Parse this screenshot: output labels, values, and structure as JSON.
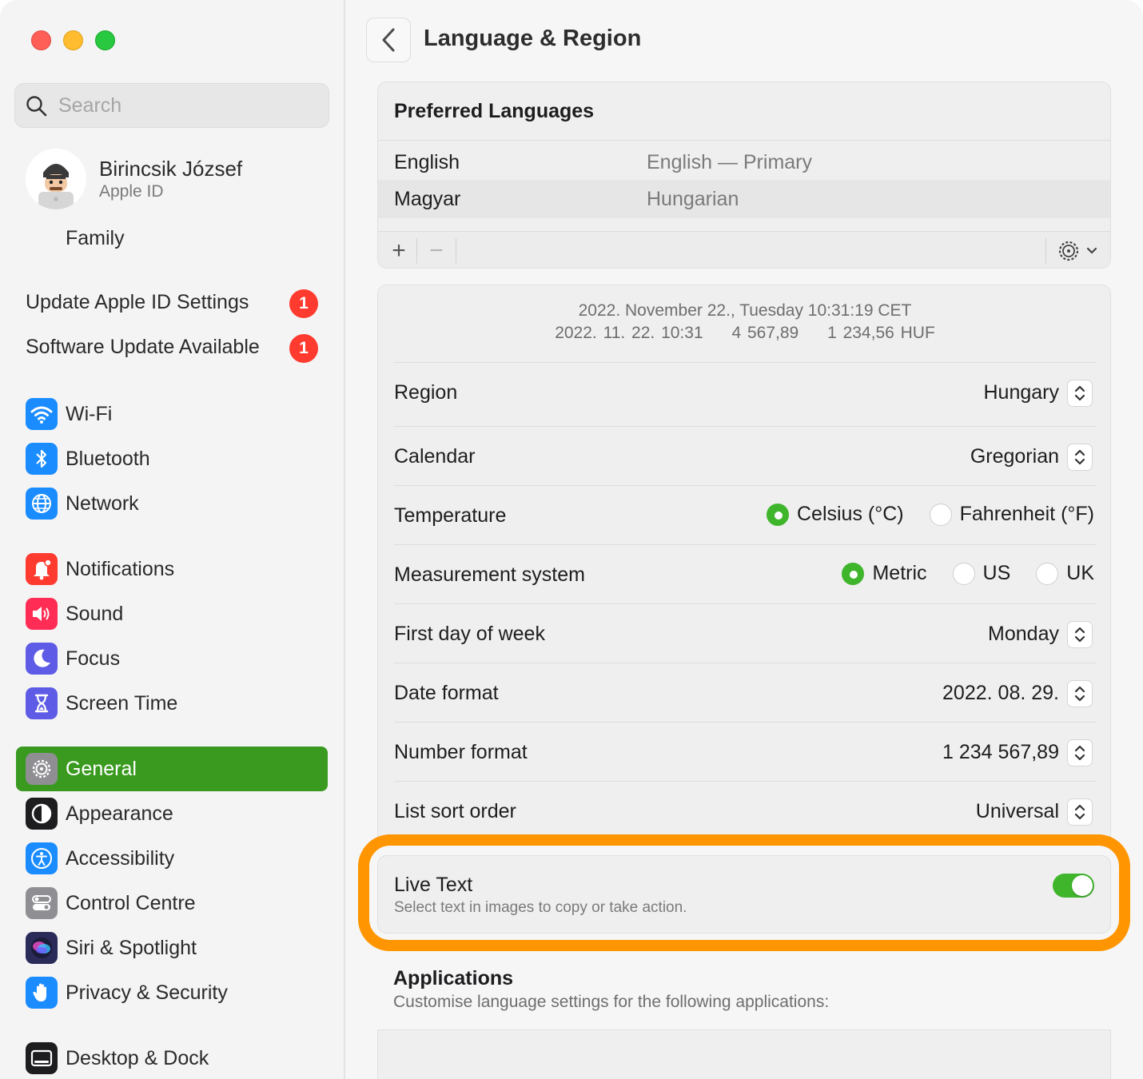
{
  "sidebar": {
    "search_placeholder": "Search",
    "account": {
      "name": "Birincsik József",
      "subtitle": "Apple ID"
    },
    "family": "Family",
    "alerts": [
      {
        "label": "Update Apple ID Settings",
        "badge": "1"
      },
      {
        "label": "Software Update Available",
        "badge": "1"
      }
    ],
    "items": [
      {
        "label": "Wi-Fi",
        "icon": "wifi-icon",
        "color": "#1a8cff"
      },
      {
        "label": "Bluetooth",
        "icon": "bluetooth-icon",
        "color": "#1a8cff"
      },
      {
        "label": "Network",
        "icon": "globe-icon",
        "color": "#1a8cff"
      },
      {
        "label": "Notifications",
        "icon": "bell-icon",
        "color": "#ff3b30"
      },
      {
        "label": "Sound",
        "icon": "speaker-icon",
        "color": "#ff2d55"
      },
      {
        "label": "Focus",
        "icon": "moon-icon",
        "color": "#5e5ce6"
      },
      {
        "label": "Screen Time",
        "icon": "hourglass-icon",
        "color": "#5e5ce6"
      },
      {
        "label": "General",
        "icon": "gear-icon",
        "color": "#8e8e93",
        "active": true
      },
      {
        "label": "Appearance",
        "icon": "appearance-icon",
        "color": "#1d1d1f"
      },
      {
        "label": "Accessibility",
        "icon": "accessibility-icon",
        "color": "#1a8cff"
      },
      {
        "label": "Control Centre",
        "icon": "toggles-icon",
        "color": "#8e8e93"
      },
      {
        "label": "Siri & Spotlight",
        "icon": "siri-icon",
        "color": "#2b2b5a"
      },
      {
        "label": "Privacy & Security",
        "icon": "hand-icon",
        "color": "#1a8cff"
      },
      {
        "label": "Desktop & Dock",
        "icon": "dock-icon",
        "color": "#1d1d1f"
      }
    ]
  },
  "main": {
    "title": "Language & Region",
    "preferred_languages": {
      "header": "Preferred Languages",
      "rows": [
        {
          "name": "English",
          "detail": "English — Primary"
        },
        {
          "name": "Magyar",
          "detail": "Hungarian"
        }
      ],
      "add": "+",
      "remove": "−"
    },
    "preview": {
      "line1": "2022. November 22., Tuesday 10:31:19 CET",
      "date_short": "2022. 11. 22. 10:31",
      "number": "4 567,89",
      "currency": "1 234,56 HUF"
    },
    "settings": {
      "region": {
        "label": "Region",
        "value": "Hungary"
      },
      "calendar": {
        "label": "Calendar",
        "value": "Gregorian"
      },
      "temperature": {
        "label": "Temperature",
        "options": [
          "Celsius (°C)",
          "Fahrenheit (°F)"
        ],
        "selected": "Celsius (°C)"
      },
      "measurement": {
        "label": "Measurement system",
        "options": [
          "Metric",
          "US",
          "UK"
        ],
        "selected": "Metric"
      },
      "first_day": {
        "label": "First day of week",
        "value": "Monday"
      },
      "date_format": {
        "label": "Date format",
        "value": "2022. 08. 29."
      },
      "number_format": {
        "label": "Number format",
        "value": "1 234 567,89"
      },
      "sort_order": {
        "label": "List sort order",
        "value": "Universal"
      }
    },
    "live_text": {
      "title": "Live Text",
      "subtitle": "Select text in images to copy or take action.",
      "enabled": true
    },
    "applications": {
      "title": "Applications",
      "subtitle": "Customise language settings for the following applications:"
    }
  },
  "colors": {
    "accent": "#3a9a1f",
    "highlight": "#ff9500",
    "badge": "#ff3b30"
  }
}
